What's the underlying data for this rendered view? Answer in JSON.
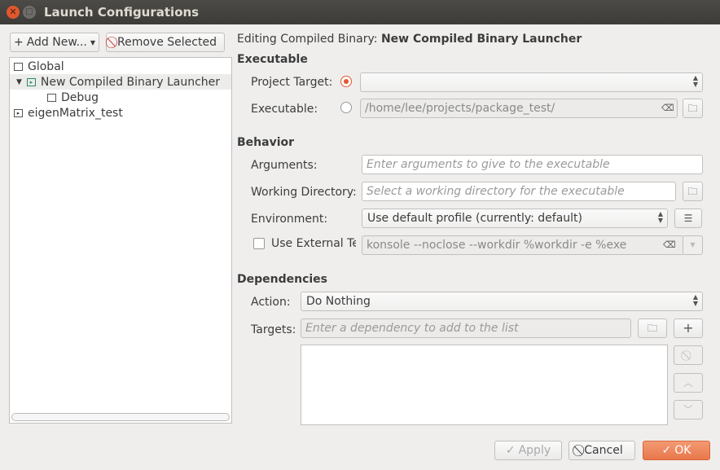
{
  "window": {
    "title": "Launch Configurations"
  },
  "toolbar": {
    "add_new": "Add New...",
    "remove_selected": "Remove Selected"
  },
  "tree": [
    {
      "label": "Global",
      "icon": "folder-icon"
    },
    {
      "label": "New Compiled Binary Launcher",
      "icon": "launcher-icon",
      "expanded": true,
      "selected": true
    },
    {
      "label": "Debug",
      "icon": "debug-icon"
    },
    {
      "label": "eigenMatrix_test",
      "icon": "launcher-icon"
    }
  ],
  "editing": {
    "prefix": "Editing Compiled Binary:",
    "name": "New Compiled Binary Launcher"
  },
  "executable": {
    "header": "Executable",
    "project_target_label": "Project Target:",
    "project_target_value": "",
    "project_target_selected": true,
    "executable_label": "Executable:",
    "executable_value": "/home/lee/projects/package_test/"
  },
  "behavior": {
    "header": "Behavior",
    "arguments_label": "Arguments:",
    "arguments_placeholder": "Enter arguments to give to the executable",
    "workdir_label": "Working Directory:",
    "workdir_placeholder": "Select a working directory for the executable",
    "environment_label": "Environment:",
    "environment_value": "Use default profile (currently: default)",
    "external_terminal_label": "Use External Te",
    "external_terminal_checked": false,
    "external_terminal_value": "konsole --noclose --workdir %workdir -e %exe"
  },
  "dependencies": {
    "header": "Dependencies",
    "action_label": "Action:",
    "action_value": "Do Nothing",
    "targets_label": "Targets:",
    "targets_placeholder": "Enter a dependency to add to the list"
  },
  "footer": {
    "apply": "Apply",
    "cancel": "Cancel",
    "ok": "OK"
  },
  "colors": {
    "accent": "#e0582e",
    "titlebar": "#3c3b37"
  }
}
